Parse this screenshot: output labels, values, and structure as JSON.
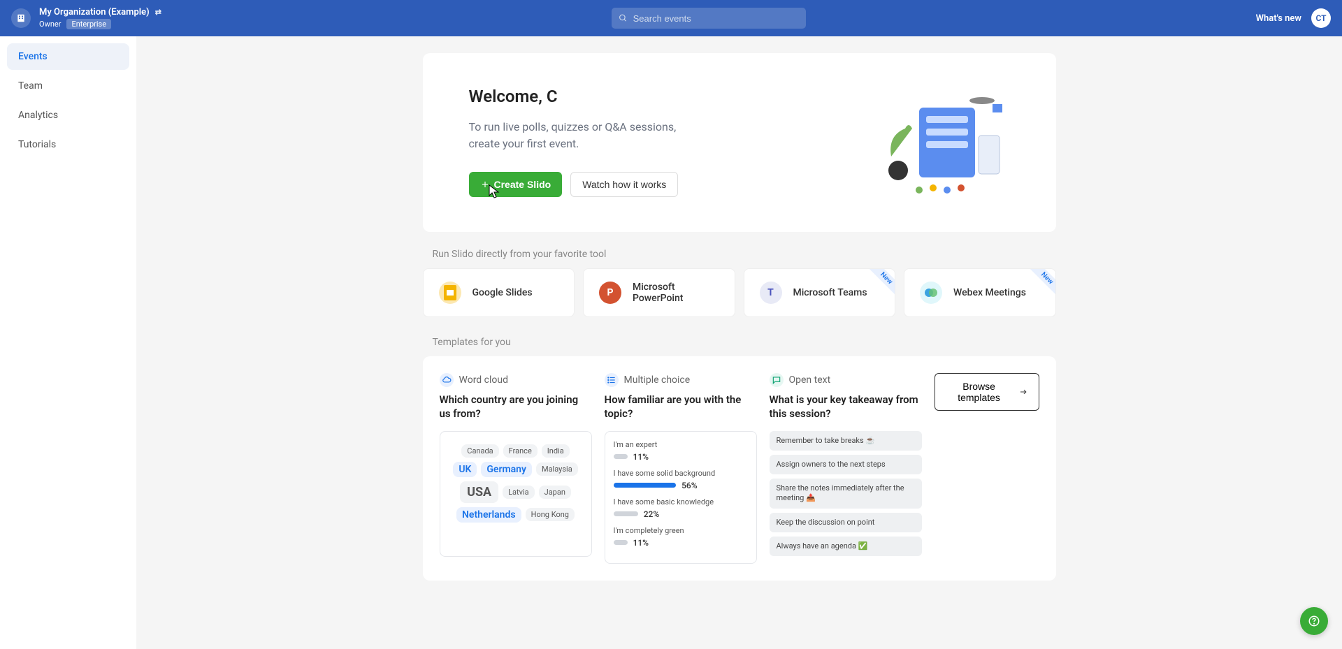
{
  "header": {
    "org_name": "My Organization (Example)",
    "role": "Owner",
    "plan": "Enterprise",
    "search_placeholder": "Search events",
    "whats_new": "What's new",
    "avatar": "CT"
  },
  "sidebar": {
    "items": [
      {
        "label": "Events",
        "active": true
      },
      {
        "label": "Team",
        "active": false
      },
      {
        "label": "Analytics",
        "active": false
      },
      {
        "label": "Tutorials",
        "active": false
      }
    ]
  },
  "welcome": {
    "title": "Welcome, C",
    "subtitle": "To run live polls, quizzes or Q&A sessions, create your first event.",
    "create_label": "Create Slido",
    "watch_label": "Watch how it works"
  },
  "tools_section_title": "Run Slido directly from your favorite tool",
  "tools": [
    {
      "label": "Google Slides",
      "color": "#f4b400",
      "new": false
    },
    {
      "label": "Microsoft PowerPoint",
      "color": "#d35230",
      "new": false
    },
    {
      "label": "Microsoft Teams",
      "color": "#4b53bc",
      "new": true
    },
    {
      "label": "Webex Meetings",
      "color": "#00bceb",
      "new": true
    }
  ],
  "new_badge": "New",
  "templates_section_title": "Templates for you",
  "templates": {
    "word_cloud": {
      "type_label": "Word cloud",
      "question": "Which country are you joining us from?",
      "words": [
        {
          "text": "Canada",
          "size": "sm"
        },
        {
          "text": "France",
          "size": "sm"
        },
        {
          "text": "India",
          "size": "sm"
        },
        {
          "text": "UK",
          "size": "med",
          "blue": true
        },
        {
          "text": "Germany",
          "size": "med",
          "blue": true
        },
        {
          "text": "Malaysia",
          "size": "sm"
        },
        {
          "text": "USA",
          "size": "big"
        },
        {
          "text": "Latvia",
          "size": "sm"
        },
        {
          "text": "Japan",
          "size": "sm"
        },
        {
          "text": "Netherlands",
          "size": "med",
          "blue": true
        },
        {
          "text": "Hong Kong",
          "size": "sm"
        }
      ]
    },
    "multiple_choice": {
      "type_label": "Multiple choice",
      "question": "How familiar are you with the topic?",
      "options": [
        {
          "label": "I'm an expert",
          "pct": 11,
          "filled": false
        },
        {
          "label": "I have some solid background",
          "pct": 56,
          "filled": true
        },
        {
          "label": "I have some basic knowledge",
          "pct": 22,
          "filled": false
        },
        {
          "label": "I'm completely green",
          "pct": 11,
          "filled": false
        }
      ]
    },
    "open_text": {
      "type_label": "Open text",
      "question": "What is your key takeaway from this session?",
      "responses": [
        "Remember to take breaks ☕",
        "Assign owners to the next steps",
        "Share the notes immediately after the meeting 📤",
        "Keep the discussion on point",
        "Always have an agenda ✅"
      ]
    },
    "browse_label": "Browse templates"
  }
}
